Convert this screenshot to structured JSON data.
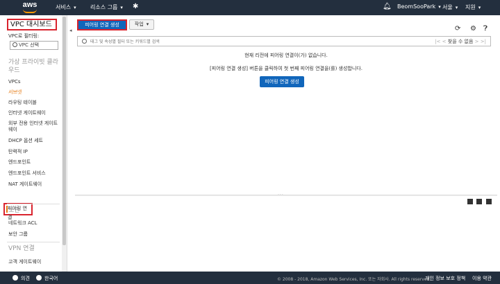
{
  "topnav": {
    "logo_text": "aws",
    "services": "서비스",
    "resource_groups": "리소스 그룹",
    "user": "BeomSooPark",
    "region": "서울",
    "support": "지원"
  },
  "sidebar": {
    "title": "VPC 대시보드",
    "filter_label": "VPC로 필터링:",
    "vpc_select": "VPC 선택",
    "section_virtual_cloud": "가상 프라이빗 클라우드",
    "items_vpc": [
      "VPCs",
      "서브넷",
      "라우팅 테이블",
      "인터넷 게이트웨이",
      "외부 전용 인터넷 게이트웨이",
      "DHCP 옵션 세트",
      "탄력적 IP",
      "엔드포인트",
      "엔드포인트 서비스",
      "NAT 게이트웨이",
      "피어링 연결"
    ],
    "section_security": "보안",
    "items_security": [
      "네트워크 ACL",
      "보안 그룹"
    ],
    "section_vpn": "VPN 연결",
    "items_vpn": [
      "고객 게이트웨이"
    ]
  },
  "main": {
    "create_button": "피어링 연결 생성",
    "actions_button": "작업",
    "search_placeholder": "태그 및 속성별 필터 또는 키워드별 검색",
    "pager_text": "찾을 수 없음",
    "empty_message_1": "현재 리전에 피어링 연결이(가) 없습니다.",
    "empty_message_2": "[피어링 연결 생성] 버튼을 클릭하여 첫 번째 피어링 연결을(를) 생성합니다.",
    "center_create_button": "피어링 연결 생성"
  },
  "footer": {
    "feedback": "의견",
    "language": "한국어",
    "copyright": "© 2008 - 2018, Amazon Web Services, Inc. 또는 자회사. All rights reserved.",
    "privacy": "개인 정보 보호 정책",
    "terms": "이용 약관"
  },
  "colors": {
    "nav_bg": "#232f3e",
    "primary_button": "#1166bb",
    "highlight_red": "#d9232d",
    "active_orange": "#e47911"
  }
}
